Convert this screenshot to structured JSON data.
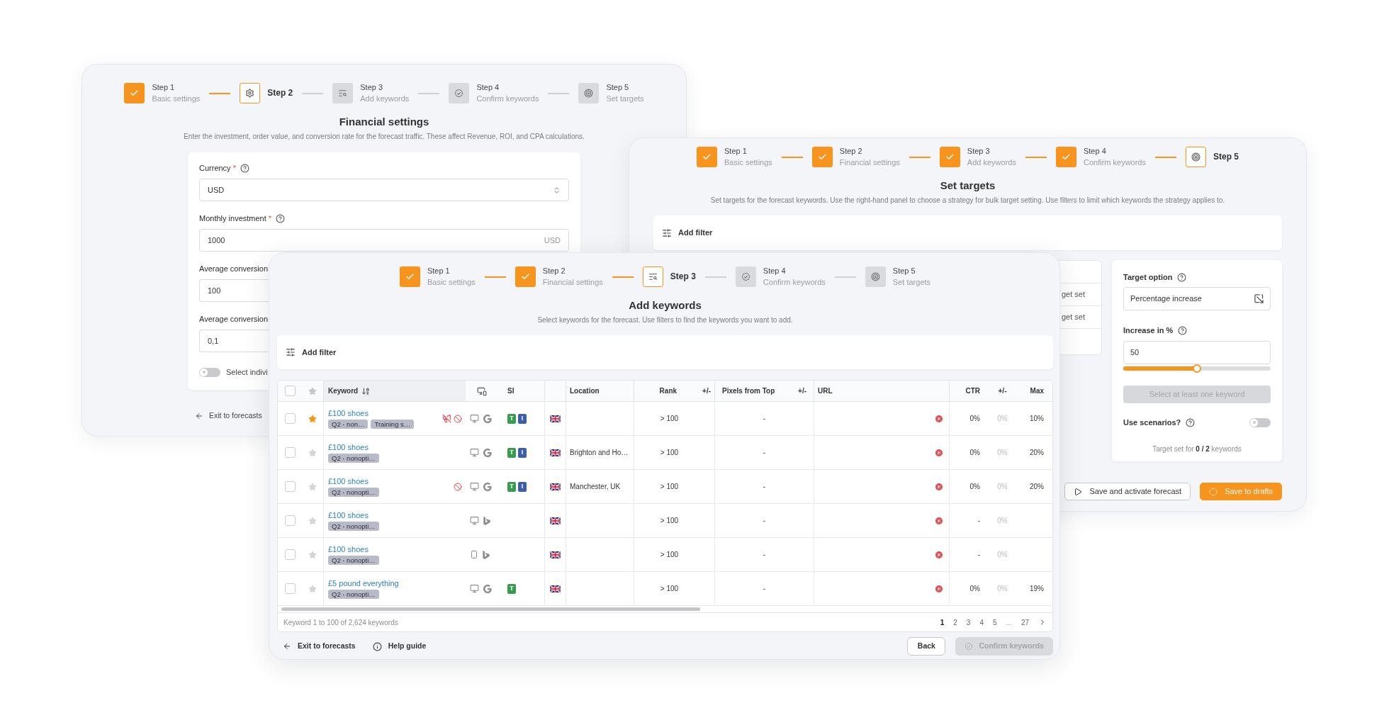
{
  "financial_window": {
    "steps": [
      {
        "label": "Step 1",
        "sublabel": "Basic settings",
        "done": true,
        "selected": false
      },
      {
        "label": "Step 2",
        "done": false,
        "selected": true
      },
      {
        "label": "Step 3",
        "sublabel": "Add keywords",
        "done": false,
        "selected": false
      },
      {
        "label": "Step 4",
        "sublabel": "Confirm keywords",
        "done": false,
        "selected": false
      },
      {
        "label": "Step 5",
        "sublabel": "Set targets",
        "done": false,
        "selected": false
      }
    ],
    "title": "Financial settings",
    "description": "Enter the investment, order value, and conversion rate for the forecast traffic. These affect Revenue, ROI, and CPA calculations.",
    "fields": [
      {
        "kind": "select",
        "label": "Currency",
        "required_mark": "*",
        "help_icon": true,
        "value": "USD"
      },
      {
        "kind": "input",
        "label": "Monthly investment",
        "required_mark": "*",
        "help_icon": true,
        "value": "1000",
        "suffix": "USD"
      },
      {
        "kind": "input",
        "label": "Average conversion",
        "value": "100"
      },
      {
        "kind": "input",
        "label": "Average conversion",
        "value": "0,1"
      }
    ],
    "toggle": {
      "label": "Select indivi",
      "on": false
    },
    "exit_link": "Exit to forecasts"
  },
  "targets_window": {
    "steps": [
      {
        "label": "Step 1",
        "sublabel": "Basic settings",
        "done": true,
        "selected": false
      },
      {
        "label": "Step 2",
        "sublabel": "Financial settings",
        "done": true,
        "selected": false
      },
      {
        "label": "Step 3",
        "sublabel": "Add keywords",
        "done": true,
        "selected": false
      },
      {
        "label": "Step 4",
        "sublabel": "Confirm keywords",
        "done": true,
        "selected": false
      },
      {
        "label": "Step 5",
        "done": false,
        "selected": true
      }
    ],
    "title": "Set targets",
    "description": "Set targets for the forecast keywords. Use the right-hand panel to choose a strategy for bulk target setting. Use filters to limit which keywords the strategy applies to.",
    "filter_label": "Add filter",
    "partial_rows": [
      "get set",
      "get set"
    ],
    "target_panel": {
      "option_label": "Target option",
      "option_value": "Percentage increase",
      "increase_label": "Increase in %",
      "increase_value": "50",
      "level": 0.5,
      "apply_button": {
        "label": "Select at least one keyword",
        "disabled": true
      },
      "scenarios": {
        "label": "Use scenarios?",
        "on": false
      },
      "summary": "Target set for **0 / 2** keywords"
    },
    "actions": [
      {
        "kind": "outline",
        "label": "Save and activate forecast"
      },
      {
        "kind": "primary",
        "label": "Save to drafts"
      }
    ]
  },
  "keywords_window": {
    "steps": [
      {
        "label": "Step 1",
        "sublabel": "Basic settings",
        "done": true,
        "selected": false
      },
      {
        "label": "Step 2",
        "sublabel": "Financial settings",
        "done": true,
        "selected": false
      },
      {
        "label": "Step 3",
        "done": false,
        "selected": true
      },
      {
        "label": "Step 4",
        "sublabel": "Confirm keywords",
        "done": false,
        "selected": false
      },
      {
        "label": "Step 5",
        "sublabel": "Set targets",
        "done": false,
        "selected": false
      }
    ],
    "title": "Add keywords",
    "description": "Select keywords for the forecast. Use filters to find the keywords you want to add.",
    "filter_label": "Add filter",
    "table": {
      "header": {
        "all_checked": false,
        "keyword": "Keyword",
        "si": "SI",
        "location": "Location",
        "rank": "Rank",
        "rank_change": "+/-",
        "pixels": "Pixels from Top",
        "pixels_change": "+/-",
        "url": "URL",
        "ctr": "CTR",
        "ctr_change": "+/-",
        "max": "Max"
      },
      "rows": [
        {
          "checked": false,
          "starred": true,
          "keyword": "£100 shoes",
          "tags": [
            "Q2 - non…",
            "Training s…"
          ],
          "alert_icons": [
            {
              "kind": "ads_off"
            },
            {
              "kind": "blocked"
            }
          ],
          "device": {
            "kind": "desktop"
          },
          "engine": {
            "kind": "google"
          },
          "si": [
            {
              "label": "T",
              "color": "#3b9a4e"
            },
            {
              "label": "I",
              "color": "#3e5ea8"
            }
          ],
          "rank": "> 100",
          "pixels": "-",
          "url_error": true,
          "ctr": "0%",
          "ctr_change": "0%",
          "max": "10%"
        },
        {
          "checked": false,
          "starred": false,
          "keyword": "£100 shoes",
          "tags": [
            "Q2 - nonopti…"
          ],
          "device": {
            "kind": "desktop"
          },
          "engine": {
            "kind": "google"
          },
          "si": [
            {
              "label": "T",
              "color": "#3b9a4e"
            },
            {
              "label": "I",
              "color": "#3e5ea8"
            }
          ],
          "location": "Brighton and Ho…",
          "rank": "> 100",
          "pixels": "-",
          "url_error": true,
          "ctr": "0%",
          "ctr_change": "0%",
          "max": "20%"
        },
        {
          "checked": false,
          "starred": false,
          "keyword": "£100 shoes",
          "tags": [
            "Q2 - nonopti…"
          ],
          "alert_icons": [
            {
              "kind": "blocked"
            }
          ],
          "device": {
            "kind": "desktop"
          },
          "engine": {
            "kind": "google"
          },
          "si": [
            {
              "label": "T",
              "color": "#3b9a4e"
            },
            {
              "label": "I",
              "color": "#3e5ea8"
            }
          ],
          "location": "Manchester, UK",
          "rank": "> 100",
          "pixels": "-",
          "url_error": true,
          "ctr": "0%",
          "ctr_change": "0%",
          "max": "20%"
        },
        {
          "checked": false,
          "starred": false,
          "keyword": "£100 shoes",
          "tags": [
            "Q2 - nonopti…"
          ],
          "device": {
            "kind": "desktop"
          },
          "engine": {
            "kind": "bing"
          },
          "rank": "> 100",
          "pixels": "-",
          "url_error": true,
          "ctr": "-",
          "ctr_change": "0%"
        },
        {
          "checked": false,
          "starred": false,
          "keyword": "£100 shoes",
          "tags": [
            "Q2 - nonopti…"
          ],
          "device": {
            "kind": "mobile"
          },
          "engine": {
            "kind": "bing"
          },
          "rank": "> 100",
          "pixels": "-",
          "url_error": true,
          "ctr": "-",
          "ctr_change": "0%"
        },
        {
          "checked": false,
          "starred": false,
          "keyword": "£5 pound everything",
          "tags": [
            "Q2 - nonopti…"
          ],
          "device": {
            "kind": "desktop"
          },
          "engine": {
            "kind": "google"
          },
          "si": [
            {
              "label": "T",
              "color": "#3b9a4e"
            }
          ],
          "rank": "> 100",
          "pixels": "-",
          "url_error": true,
          "ctr": "0%",
          "ctr_change": "0%",
          "max": "19%"
        }
      ],
      "summary": "Keyword 1 to 100 of 2,624 keywords",
      "pages": [
        {
          "label": "1",
          "selected": true
        },
        {
          "label": "2",
          "selected": false
        },
        {
          "label": "3",
          "selected": false
        },
        {
          "label": "4",
          "selected": false
        },
        {
          "label": "5",
          "selected": false
        }
      ],
      "ellipsis": "...",
      "last_page": {
        "label": "27",
        "selected": false
      }
    },
    "exit_link": "Exit to forecasts",
    "help_link": "Help guide",
    "back_button": "Back",
    "confirm_button": {
      "label": "Confirm keywords",
      "disabled": true
    }
  }
}
